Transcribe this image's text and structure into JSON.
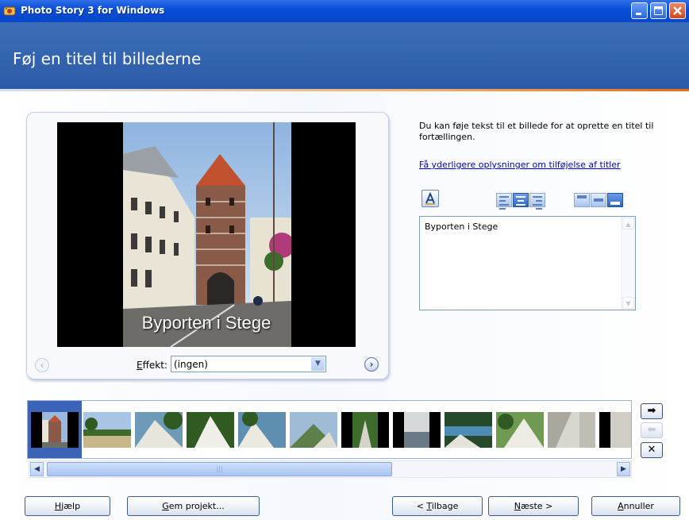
{
  "window": {
    "title": "Photo Story 3 for Windows",
    "icon": "photo-story-app-icon",
    "controls": [
      "minimize",
      "maximize",
      "close"
    ]
  },
  "header": {
    "title": "Føj en titel til billederne"
  },
  "preview": {
    "caption": "Byporten i Stege",
    "prev_icon": "chevron-left-icon",
    "next_icon": "chevron-right-icon",
    "effect_label": "Effekt:",
    "effect_accesskey": "E",
    "effect_value": "(ingen)"
  },
  "info": {
    "text": "Du kan føje tekst til et billede for at oprette en titel til fortællingen.",
    "link": "Få yderligere oplysninger om tilføjelse af titler"
  },
  "toolbar": {
    "font_icon": "select-font-icon",
    "horizontal_align": [
      "left",
      "center",
      "right"
    ],
    "horizontal_selected": "center",
    "vertical_align": [
      "top",
      "middle",
      "bottom"
    ],
    "vertical_selected": "bottom"
  },
  "textbox": {
    "value": "Byporten i Stege"
  },
  "filmstrip": {
    "selected_index": 0,
    "thumbnail_count": 12,
    "move_right_icon": "arrow-right-icon",
    "move_left_icon": "arrow-left-icon",
    "delete_icon": "close-x-icon"
  },
  "buttons": {
    "help": {
      "pre": "",
      "key": "H",
      "post": "jælp"
    },
    "save": {
      "pre": "",
      "key": "G",
      "post": "em projekt..."
    },
    "back": {
      "pre": "< ",
      "key": "T",
      "post": "ilbage"
    },
    "next": {
      "pre": "",
      "key": "N",
      "post": "æste >"
    },
    "cancel": {
      "pre": "",
      "key": "A",
      "post": "nnuller"
    }
  },
  "colors": {
    "titlebar": "#0a4fd8",
    "header": "#3d6eb7",
    "accent_line": "#e86b10",
    "selection": "#3b63b8",
    "link": "#0000cc"
  }
}
